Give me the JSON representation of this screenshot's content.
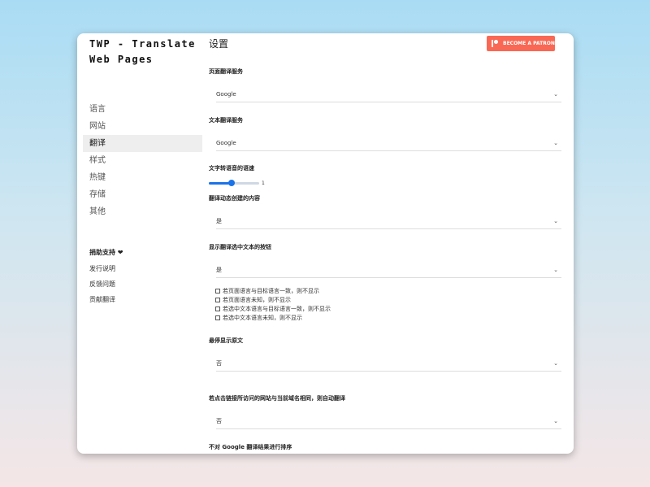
{
  "app": {
    "title_line1": "TWP - Translate",
    "title_line2": "Web Pages"
  },
  "sidebar": {
    "nav": [
      {
        "label": "语言",
        "active": false
      },
      {
        "label": "网站",
        "active": false
      },
      {
        "label": "翻译",
        "active": true
      },
      {
        "label": "样式",
        "active": false
      },
      {
        "label": "热键",
        "active": false
      },
      {
        "label": "存储",
        "active": false
      },
      {
        "label": "其他",
        "active": false
      }
    ],
    "donate": "捐助支持 ❤",
    "links": [
      "发行说明",
      "反馈问题",
      "贡献翻译"
    ]
  },
  "main": {
    "title": "设置",
    "patron_label": "BECOME A PATRON",
    "page_translation_service": {
      "label": "页面翻译服务",
      "value": "Google"
    },
    "text_translation_service": {
      "label": "文本翻译服务",
      "value": "Google"
    },
    "tts_speed": {
      "label": "文字转语音的语速",
      "value": "1",
      "level": 0.45
    },
    "translate_dynamic": {
      "label": "翻译动态创建的内容",
      "value": "是"
    },
    "show_button": {
      "label": "显示翻译选中文本的按钮",
      "value": "是",
      "options": [
        "若页面语言与目标语言一致，则不显示",
        "若页面语言未知，则不显示",
        "若选中文本语言与目标语言一致，则不显示",
        "若选中文本语言未知，则不显示"
      ]
    },
    "hover_original": {
      "label": "悬停显示原文",
      "value": "否"
    },
    "auto_translate_same_domain": {
      "label": "若点击链接所访问的网站与当前域名相同，则自动翻译",
      "value": "否"
    },
    "no_sort_google": {
      "label": "不对 Google 翻译结果进行排序"
    }
  },
  "icons": {
    "chevron": "chevron-down-icon",
    "patreon": "patreon-icon"
  },
  "colors": {
    "accent": "#1a73e8",
    "patron": "#f96854"
  }
}
